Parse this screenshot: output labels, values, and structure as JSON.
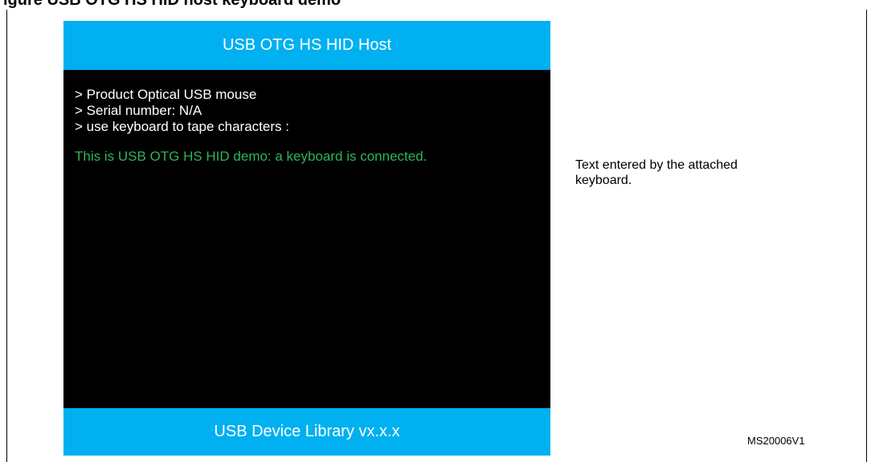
{
  "figure": {
    "caption": "igure     USB OTG HS HID host keyboard demo",
    "id": "MS20006V1"
  },
  "screen": {
    "header": "USB OTG HS HID Host",
    "info_lines": [
      "> Product Optical USB mouse",
      "> Serial number:  N/A",
      "> use keyboard to tape characters :"
    ],
    "typed_text": "This is USB OTG HS HID demo:  a keyboard is connected.",
    "footer": "USB Device Library vx.x.x",
    "colors": {
      "banner": "#00b0f0",
      "background": "#000000",
      "info_text": "#ffffff",
      "typed_text": "#2fb457"
    }
  },
  "annotation": {
    "text": "Text entered by the attached keyboard."
  }
}
